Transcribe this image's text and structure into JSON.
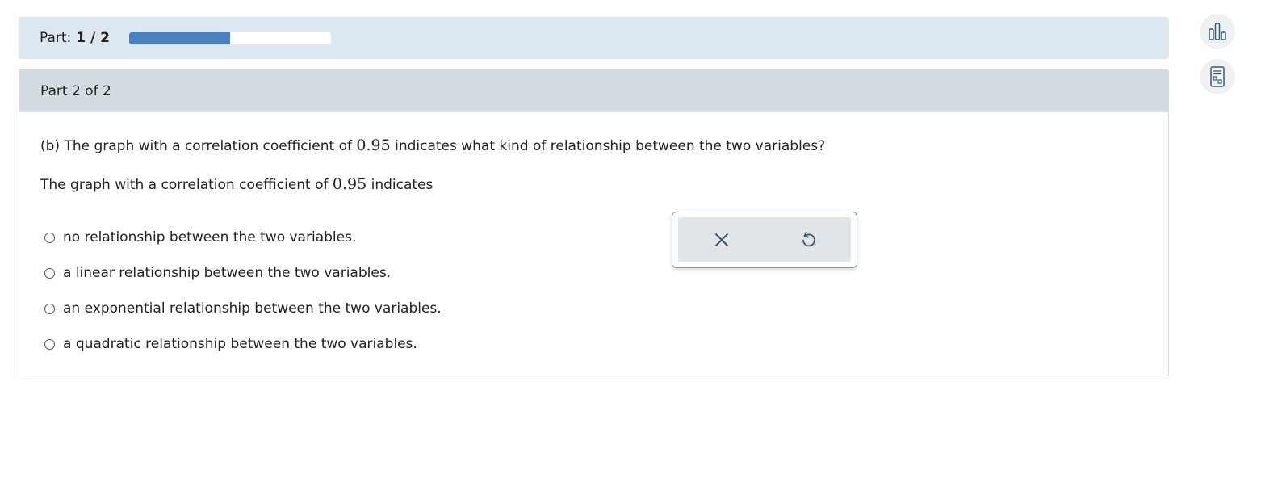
{
  "part_bar": {
    "label": "Part:",
    "current": "1 / 2",
    "progress_fraction": 0.5,
    "progress_color": "#4a7fc0"
  },
  "card": {
    "header": "Part 2 of 2",
    "question_prefix": "(b) The graph with a correlation coefficient of",
    "question_value": "0.95",
    "question_suffix": "indicates what kind of relationship between the two variables?",
    "statement_prefix": "The graph with a correlation coefficient of",
    "statement_value": "0.95",
    "statement_suffix": "indicates",
    "options": [
      {
        "label": "no relationship between the two variables."
      },
      {
        "label": "a linear relationship between the two variables."
      },
      {
        "label": "an exponential relationship between the two variables."
      },
      {
        "label": "a quadratic relationship between the two variables."
      }
    ]
  },
  "popup": {
    "clear_icon": "close-icon",
    "undo_icon": "undo-icon"
  },
  "sidebar": {
    "buttons": [
      {
        "icon": "bar-chart-icon"
      },
      {
        "icon": "calculator-icon"
      }
    ]
  }
}
